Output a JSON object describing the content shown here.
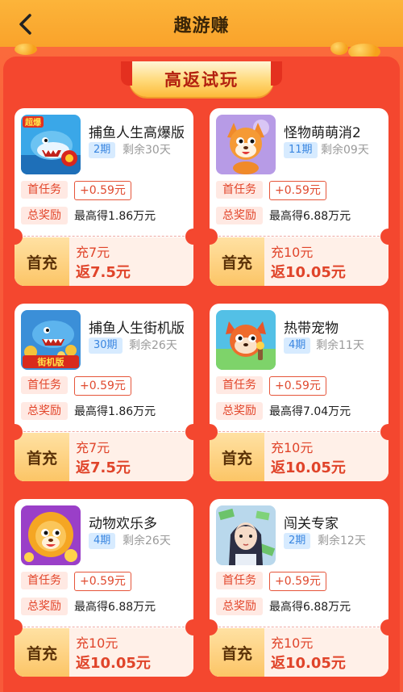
{
  "header": {
    "title": "趣游赚"
  },
  "banner": {
    "title": "高返试玩"
  },
  "cards": [
    {
      "name": "捕鱼人生高爆版",
      "period": "2期",
      "remaining": "剩余30天",
      "first_task_label": "首任务",
      "first_task_reward": "+0.59元",
      "total_label": "总奖励",
      "total_reward": "最高得1.86万元",
      "recharge_label": "首充",
      "recharge": "充7元",
      "refund": "返7.5元",
      "icon": "fish-shark-icon"
    },
    {
      "name": "怪物萌萌消2",
      "period": "11期",
      "remaining": "剩余09天",
      "first_task_label": "首任务",
      "first_task_reward": "+0.59元",
      "total_label": "总奖励",
      "total_reward": "最高得6.88万元",
      "recharge_label": "首充",
      "recharge": "充10元",
      "refund": "返10.05元",
      "icon": "fox-icon"
    },
    {
      "name": "捕鱼人生街机版",
      "period": "30期",
      "remaining": "剩余26天",
      "first_task_label": "首任务",
      "first_task_reward": "+0.59元",
      "total_label": "总奖励",
      "total_reward": "最高得1.86万元",
      "recharge_label": "首充",
      "recharge": "充7元",
      "refund": "返7.5元",
      "icon": "fish-arcade-icon"
    },
    {
      "name": "热带宠物",
      "period": "4期",
      "remaining": "剩余11天",
      "first_task_label": "首任务",
      "first_task_reward": "+0.59元",
      "total_label": "总奖励",
      "total_reward": "最高得7.04万元",
      "recharge_label": "首充",
      "recharge": "充10元",
      "refund": "返10.05元",
      "icon": "raccoon-icon"
    },
    {
      "name": "动物欢乐多",
      "period": "4期",
      "remaining": "剩余26天",
      "first_task_label": "首任务",
      "first_task_reward": "+0.59元",
      "total_label": "总奖励",
      "total_reward": "最高得6.88万元",
      "recharge_label": "首充",
      "recharge": "充10元",
      "refund": "返10.05元",
      "icon": "lion-icon"
    },
    {
      "name": "闯关专家",
      "period": "2期",
      "remaining": "剩余12天",
      "first_task_label": "首任务",
      "first_task_reward": "+0.59元",
      "total_label": "总奖励",
      "total_reward": "最高得6.88万元",
      "recharge_label": "首充",
      "recharge": "充10元",
      "refund": "返10.05元",
      "icon": "girl-money-icon"
    }
  ],
  "icon_tags": {
    "fish_hot": "超爆",
    "arcade": "街机版"
  },
  "colors": {
    "header": "#fcb43a",
    "panel": "#f4472f",
    "accent_red": "#e0442a",
    "period_blue": "#3a86e0"
  }
}
